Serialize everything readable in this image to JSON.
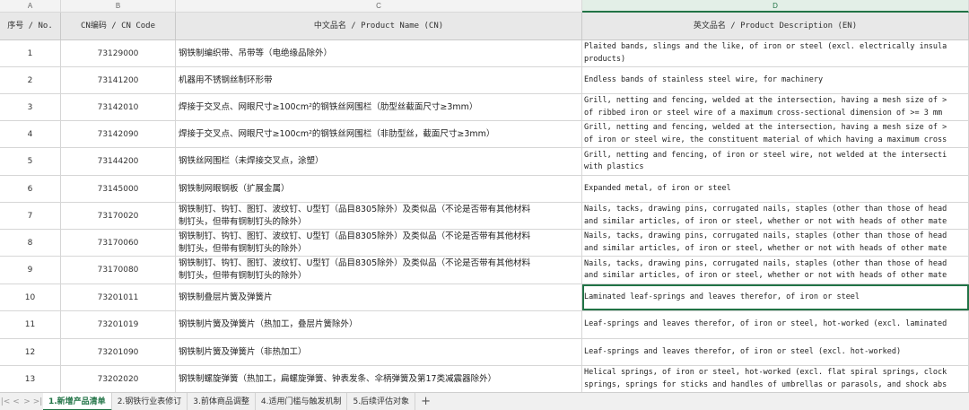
{
  "columns": {
    "letters": [
      "A",
      "B",
      "C",
      "D"
    ],
    "headers": [
      "序号 / No.",
      "CN编码 / CN Code",
      "中文品名 / Product Name (CN)",
      "英文品名 / Product Description (EN)"
    ]
  },
  "rows": [
    {
      "no": "1",
      "code": "73129000",
      "cn": [
        "钢铁制编织带、吊带等（电绝缘品除外）"
      ],
      "en": [
        "Plaited bands, slings and the like, of iron or steel (excl. electrically insula",
        "products)"
      ]
    },
    {
      "no": "2",
      "code": "73141200",
      "cn": [
        "机器用不锈钢丝制环形带"
      ],
      "en": [
        "Endless bands of stainless steel wire, for machinery"
      ]
    },
    {
      "no": "3",
      "code": "73142010",
      "cn": [
        "焊接于交叉点、网眼尺寸≥100cm²的钢铁丝网围栏（肋型丝截面尺寸≥3mm）"
      ],
      "en": [
        "Grill, netting and fencing, welded at the intersection, having a mesh size of >",
        "of ribbed iron or steel wire of a maximum cross-sectional dimension of >= 3 mm"
      ]
    },
    {
      "no": "4",
      "code": "73142090",
      "cn": [
        "焊接于交叉点、网眼尺寸≥100cm²的钢铁丝网围栏（非肋型丝，截面尺寸≥3mm）"
      ],
      "en": [
        "Grill, netting and fencing, welded at the intersection, having a mesh size of >",
        "of iron or steel wire, the constituent material of which having a maximum cross"
      ]
    },
    {
      "no": "5",
      "code": "73144200",
      "cn": [
        "钢铁丝网围栏（未焊接交叉点，涂塑）"
      ],
      "en": [
        "Grill, netting and fencing, of iron or steel wire, not welded at the intersecti",
        "with plastics"
      ]
    },
    {
      "no": "6",
      "code": "73145000",
      "cn": [
        "钢铁制网眼钢板（扩展金属）"
      ],
      "en": [
        "Expanded metal, of iron or steel"
      ]
    },
    {
      "no": "7",
      "code": "73170020",
      "cn": [
        "钢铁制钉、钩钉、图钉、波纹钉、U型钉（品目8305除外）及类似品（不论是否带有其他材料",
        "制钉头，但带有铜制钉头的除外）"
      ],
      "en": [
        "Nails, tacks, drawing pins, corrugated nails, staples (other than those of head",
        "and similar articles, of iron or steel, whether or not with heads of other mate"
      ]
    },
    {
      "no": "8",
      "code": "73170060",
      "cn": [
        "钢铁制钉、钩钉、图钉、波纹钉、U型钉（品目8305除外）及类似品（不论是否带有其他材料",
        "制钉头，但带有铜制钉头的除外）"
      ],
      "en": [
        "Nails, tacks, drawing pins, corrugated nails, staples (other than those of head",
        "and similar articles, of iron or steel, whether or not with heads of other mate"
      ]
    },
    {
      "no": "9",
      "code": "73170080",
      "cn": [
        "钢铁制钉、钩钉、图钉、波纹钉、U型钉（品目8305除外）及类似品（不论是否带有其他材料",
        "制钉头，但带有铜制钉头的除外）"
      ],
      "en": [
        "Nails, tacks, drawing pins, corrugated nails, staples (other than those of head",
        "and similar articles, of iron or steel, whether or not with heads of other mate"
      ]
    },
    {
      "no": "10",
      "code": "73201011",
      "cn": [
        "钢铁制叠层片簧及弹簧片"
      ],
      "en": [
        "Laminated leaf-springs and leaves therefor, of iron or steel"
      ]
    },
    {
      "no": "11",
      "code": "73201019",
      "cn": [
        "钢铁制片簧及弹簧片（热加工，叠层片簧除外）"
      ],
      "en": [
        "Leaf-springs and leaves therefor, of iron or steel, hot-worked (excl. laminated"
      ]
    },
    {
      "no": "12",
      "code": "73201090",
      "cn": [
        "钢铁制片簧及弹簧片（非热加工）"
      ],
      "en": [
        "Leaf-springs and leaves therefor, of iron or steel (excl. hot-worked)"
      ]
    },
    {
      "no": "13",
      "code": "73202020",
      "cn": [
        "钢铁制螺旋弹簧（热加工，扁螺旋弹簧、钟表发条、伞柄弹簧及第17类减震器除外）"
      ],
      "en": [
        "Helical springs, of iron or steel, hot-worked (excl. flat spiral springs, clock",
        "springs, springs for sticks and handles of umbrellas or parasols, and shock abs"
      ]
    }
  ],
  "tabs": [
    {
      "label": "1.新增产品清单",
      "active": true
    },
    {
      "label": "2.钢铁行业表修订",
      "active": false
    },
    {
      "label": "3.前体商品调整",
      "active": false
    },
    {
      "label": "4.适用门槛与触发机制",
      "active": false
    },
    {
      "label": "5.后续评估对象",
      "active": false
    }
  ],
  "add_tab_label": "+",
  "nav_arrows": [
    "|<",
    "<",
    ">",
    ">|"
  ]
}
